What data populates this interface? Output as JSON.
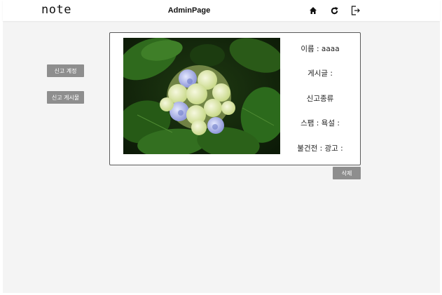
{
  "header": {
    "brand": "note",
    "title": "AdminPage",
    "icons": [
      "home-icon",
      "refresh-icon",
      "logout-icon"
    ]
  },
  "sidebar": {
    "items": [
      {
        "label": "신고 계정"
      },
      {
        "label": "신고 게시물"
      }
    ]
  },
  "report": {
    "name_line": "이름 : aaaa",
    "post_line": "게시글 :",
    "type_heading": "신고종류",
    "spam_line": "스팸 : 욕설 :",
    "bad_line": "불건전 : 광고 :"
  },
  "actions": {
    "delete_label": "삭제"
  },
  "colors": {
    "background": "#f4f4f4",
    "header": "#ffffff",
    "button": "#8e8e8e",
    "card_border": "#5a5a5a"
  }
}
